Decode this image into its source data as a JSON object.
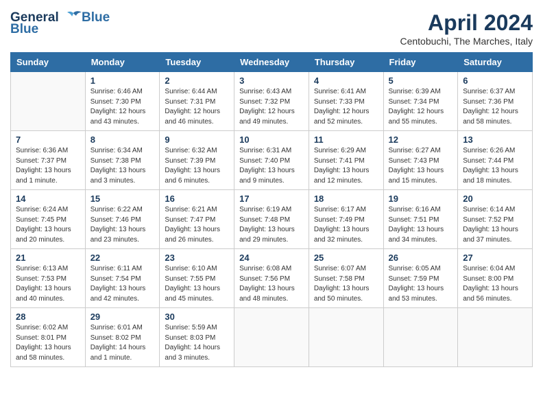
{
  "logo": {
    "line1": "General",
    "line2": "Blue"
  },
  "title": "April 2024",
  "subtitle": "Centobuchi, The Marches, Italy",
  "days_of_week": [
    "Sunday",
    "Monday",
    "Tuesday",
    "Wednesday",
    "Thursday",
    "Friday",
    "Saturday"
  ],
  "weeks": [
    [
      {
        "day": "",
        "sunrise": "",
        "sunset": "",
        "daylight": ""
      },
      {
        "day": "1",
        "sunrise": "Sunrise: 6:46 AM",
        "sunset": "Sunset: 7:30 PM",
        "daylight": "Daylight: 12 hours and 43 minutes."
      },
      {
        "day": "2",
        "sunrise": "Sunrise: 6:44 AM",
        "sunset": "Sunset: 7:31 PM",
        "daylight": "Daylight: 12 hours and 46 minutes."
      },
      {
        "day": "3",
        "sunrise": "Sunrise: 6:43 AM",
        "sunset": "Sunset: 7:32 PM",
        "daylight": "Daylight: 12 hours and 49 minutes."
      },
      {
        "day": "4",
        "sunrise": "Sunrise: 6:41 AM",
        "sunset": "Sunset: 7:33 PM",
        "daylight": "Daylight: 12 hours and 52 minutes."
      },
      {
        "day": "5",
        "sunrise": "Sunrise: 6:39 AM",
        "sunset": "Sunset: 7:34 PM",
        "daylight": "Daylight: 12 hours and 55 minutes."
      },
      {
        "day": "6",
        "sunrise": "Sunrise: 6:37 AM",
        "sunset": "Sunset: 7:36 PM",
        "daylight": "Daylight: 12 hours and 58 minutes."
      }
    ],
    [
      {
        "day": "7",
        "sunrise": "Sunrise: 6:36 AM",
        "sunset": "Sunset: 7:37 PM",
        "daylight": "Daylight: 13 hours and 1 minute."
      },
      {
        "day": "8",
        "sunrise": "Sunrise: 6:34 AM",
        "sunset": "Sunset: 7:38 PM",
        "daylight": "Daylight: 13 hours and 3 minutes."
      },
      {
        "day": "9",
        "sunrise": "Sunrise: 6:32 AM",
        "sunset": "Sunset: 7:39 PM",
        "daylight": "Daylight: 13 hours and 6 minutes."
      },
      {
        "day": "10",
        "sunrise": "Sunrise: 6:31 AM",
        "sunset": "Sunset: 7:40 PM",
        "daylight": "Daylight: 13 hours and 9 minutes."
      },
      {
        "day": "11",
        "sunrise": "Sunrise: 6:29 AM",
        "sunset": "Sunset: 7:41 PM",
        "daylight": "Daylight: 13 hours and 12 minutes."
      },
      {
        "day": "12",
        "sunrise": "Sunrise: 6:27 AM",
        "sunset": "Sunset: 7:43 PM",
        "daylight": "Daylight: 13 hours and 15 minutes."
      },
      {
        "day": "13",
        "sunrise": "Sunrise: 6:26 AM",
        "sunset": "Sunset: 7:44 PM",
        "daylight": "Daylight: 13 hours and 18 minutes."
      }
    ],
    [
      {
        "day": "14",
        "sunrise": "Sunrise: 6:24 AM",
        "sunset": "Sunset: 7:45 PM",
        "daylight": "Daylight: 13 hours and 20 minutes."
      },
      {
        "day": "15",
        "sunrise": "Sunrise: 6:22 AM",
        "sunset": "Sunset: 7:46 PM",
        "daylight": "Daylight: 13 hours and 23 minutes."
      },
      {
        "day": "16",
        "sunrise": "Sunrise: 6:21 AM",
        "sunset": "Sunset: 7:47 PM",
        "daylight": "Daylight: 13 hours and 26 minutes."
      },
      {
        "day": "17",
        "sunrise": "Sunrise: 6:19 AM",
        "sunset": "Sunset: 7:48 PM",
        "daylight": "Daylight: 13 hours and 29 minutes."
      },
      {
        "day": "18",
        "sunrise": "Sunrise: 6:17 AM",
        "sunset": "Sunset: 7:49 PM",
        "daylight": "Daylight: 13 hours and 32 minutes."
      },
      {
        "day": "19",
        "sunrise": "Sunrise: 6:16 AM",
        "sunset": "Sunset: 7:51 PM",
        "daylight": "Daylight: 13 hours and 34 minutes."
      },
      {
        "day": "20",
        "sunrise": "Sunrise: 6:14 AM",
        "sunset": "Sunset: 7:52 PM",
        "daylight": "Daylight: 13 hours and 37 minutes."
      }
    ],
    [
      {
        "day": "21",
        "sunrise": "Sunrise: 6:13 AM",
        "sunset": "Sunset: 7:53 PM",
        "daylight": "Daylight: 13 hours and 40 minutes."
      },
      {
        "day": "22",
        "sunrise": "Sunrise: 6:11 AM",
        "sunset": "Sunset: 7:54 PM",
        "daylight": "Daylight: 13 hours and 42 minutes."
      },
      {
        "day": "23",
        "sunrise": "Sunrise: 6:10 AM",
        "sunset": "Sunset: 7:55 PM",
        "daylight": "Daylight: 13 hours and 45 minutes."
      },
      {
        "day": "24",
        "sunrise": "Sunrise: 6:08 AM",
        "sunset": "Sunset: 7:56 PM",
        "daylight": "Daylight: 13 hours and 48 minutes."
      },
      {
        "day": "25",
        "sunrise": "Sunrise: 6:07 AM",
        "sunset": "Sunset: 7:58 PM",
        "daylight": "Daylight: 13 hours and 50 minutes."
      },
      {
        "day": "26",
        "sunrise": "Sunrise: 6:05 AM",
        "sunset": "Sunset: 7:59 PM",
        "daylight": "Daylight: 13 hours and 53 minutes."
      },
      {
        "day": "27",
        "sunrise": "Sunrise: 6:04 AM",
        "sunset": "Sunset: 8:00 PM",
        "daylight": "Daylight: 13 hours and 56 minutes."
      }
    ],
    [
      {
        "day": "28",
        "sunrise": "Sunrise: 6:02 AM",
        "sunset": "Sunset: 8:01 PM",
        "daylight": "Daylight: 13 hours and 58 minutes."
      },
      {
        "day": "29",
        "sunrise": "Sunrise: 6:01 AM",
        "sunset": "Sunset: 8:02 PM",
        "daylight": "Daylight: 14 hours and 1 minute."
      },
      {
        "day": "30",
        "sunrise": "Sunrise: 5:59 AM",
        "sunset": "Sunset: 8:03 PM",
        "daylight": "Daylight: 14 hours and 3 minutes."
      },
      {
        "day": "",
        "sunrise": "",
        "sunset": "",
        "daylight": ""
      },
      {
        "day": "",
        "sunrise": "",
        "sunset": "",
        "daylight": ""
      },
      {
        "day": "",
        "sunrise": "",
        "sunset": "",
        "daylight": ""
      },
      {
        "day": "",
        "sunrise": "",
        "sunset": "",
        "daylight": ""
      }
    ]
  ]
}
